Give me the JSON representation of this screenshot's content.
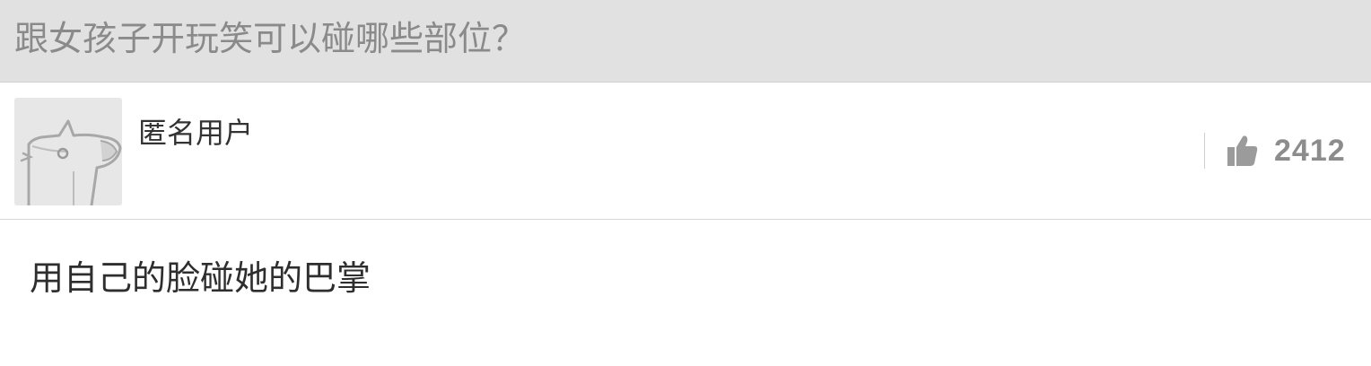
{
  "question": {
    "title": "跟女孩子开玩笑可以碰哪些部位？"
  },
  "answer": {
    "author": {
      "name": "匿名用户",
      "avatar_icon": "anonymous-avatar-icon"
    },
    "vote": {
      "icon": "thumbs-up-icon",
      "count": "2412"
    },
    "content": "用自己的脸碰她的巴掌"
  },
  "colors": {
    "question_bar_bg": "#e1e1e1",
    "question_text": "#8a8a8a",
    "author_text": "#333333",
    "vote_text": "#8c8c8c",
    "answer_text": "#2e2e2e"
  }
}
